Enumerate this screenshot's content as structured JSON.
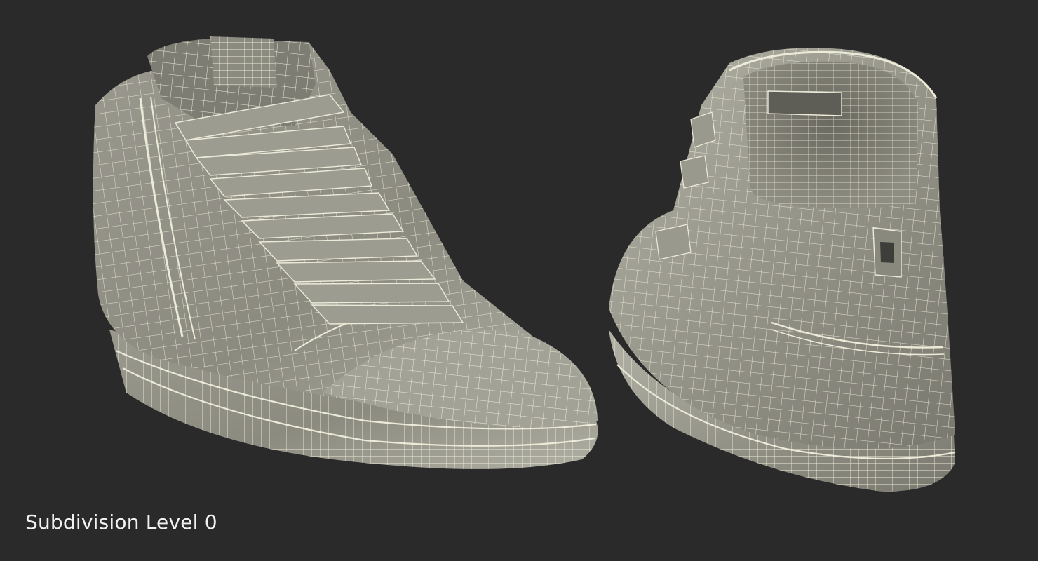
{
  "caption": "Subdivision Level 0",
  "colors": {
    "background": "#2a2a2a",
    "shade_light": "#b4b3a7",
    "shade_mid": "#8f8e83",
    "shade_dark": "#5f5e56",
    "wire": "#ecebd9",
    "caption": "#f2f2f2"
  }
}
